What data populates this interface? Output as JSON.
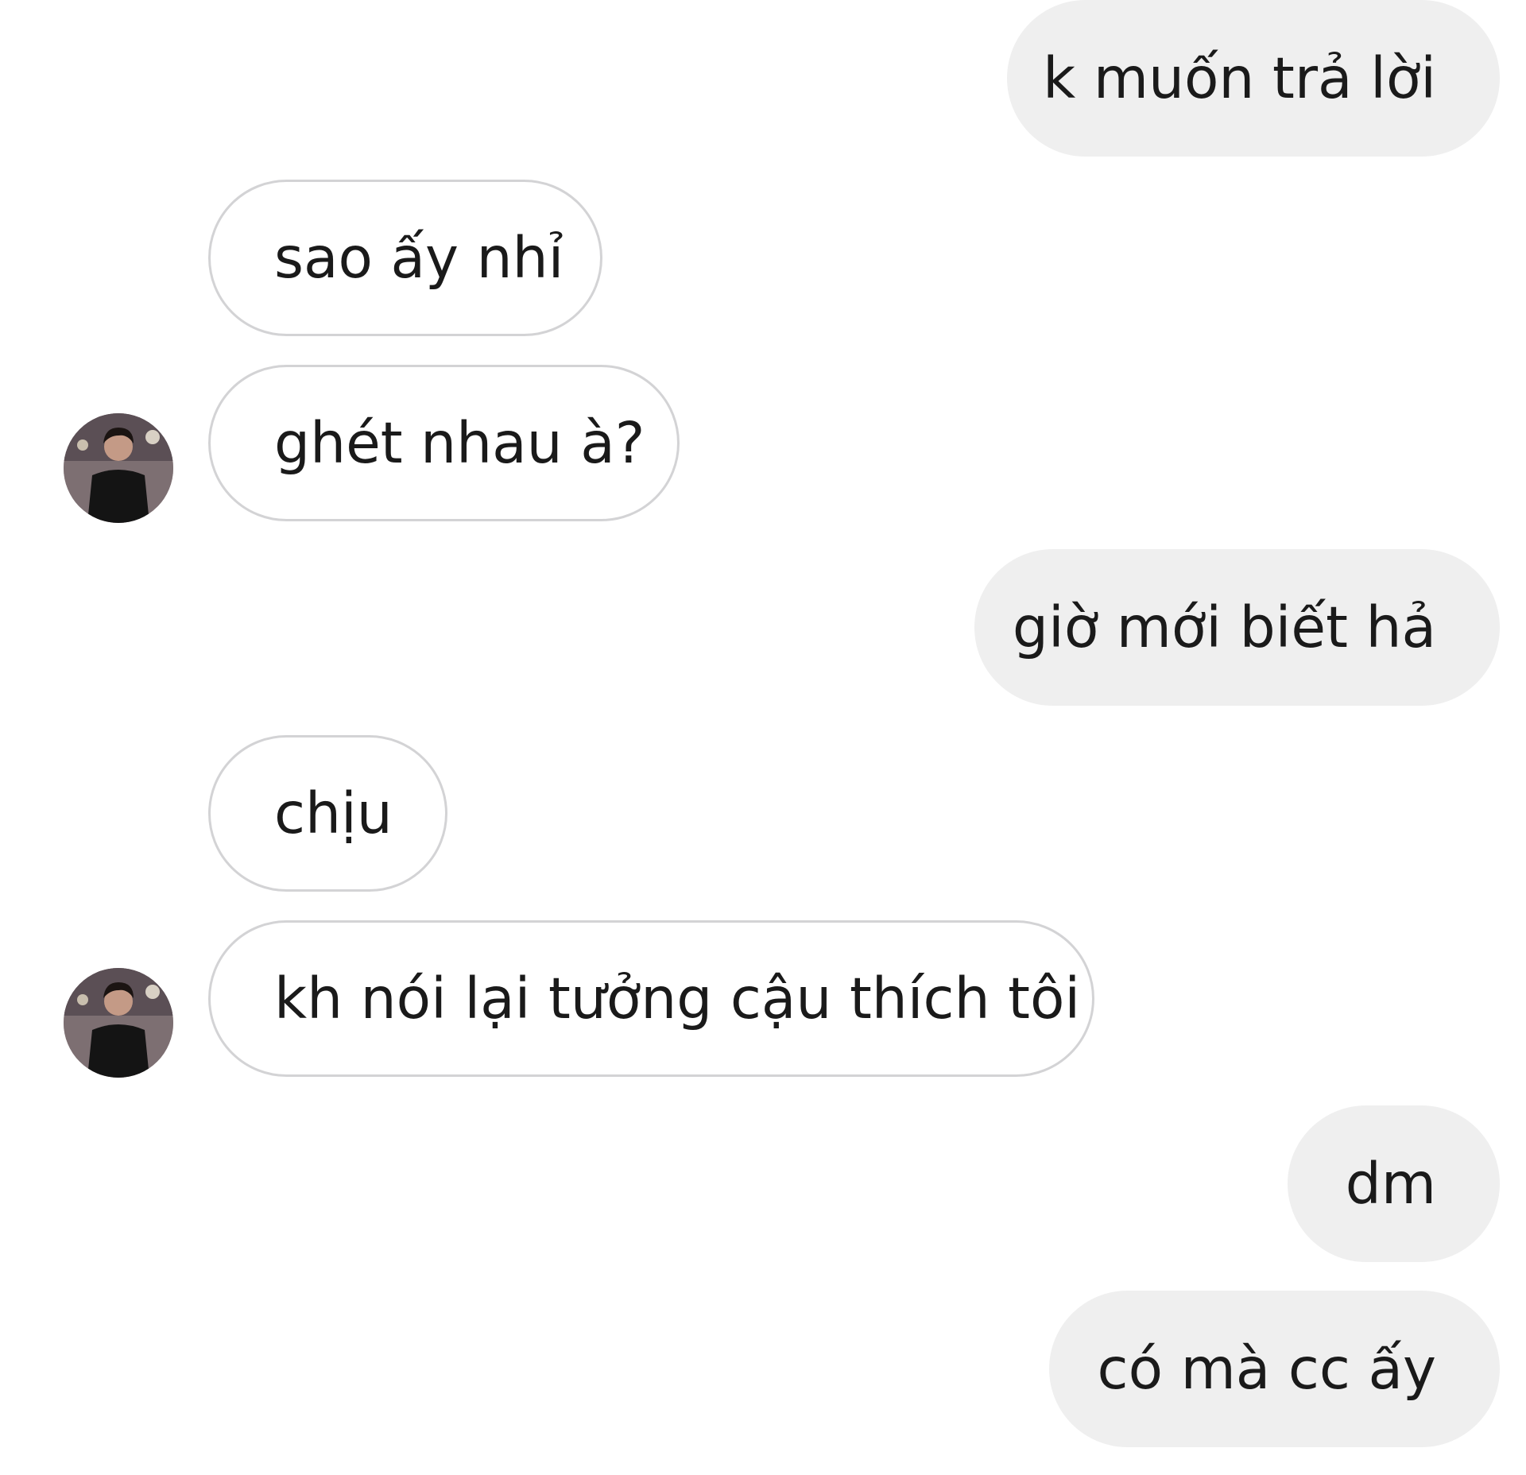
{
  "conversation": {
    "messages": [
      {
        "sender": "me",
        "text": "k muốn trả lời"
      },
      {
        "sender": "other",
        "text": "sao ấy nhỉ"
      },
      {
        "sender": "other",
        "text": "ghét nhau à?"
      },
      {
        "sender": "me",
        "text": "giờ mới biết hả"
      },
      {
        "sender": "other",
        "text": "chịu"
      },
      {
        "sender": "other",
        "text": "kh nói lại tưởng cậu thích tôi"
      },
      {
        "sender": "me",
        "text": "dm"
      },
      {
        "sender": "me",
        "text": "có mà cc ấy"
      }
    ]
  },
  "colors": {
    "sent_bubble": "#efefef",
    "received_bubble_border": "#d3d3d5",
    "text": "#1a1a1a",
    "background": "#ffffff"
  },
  "icons": {
    "contact_avatar": "profile-photo-avatar-icon"
  }
}
